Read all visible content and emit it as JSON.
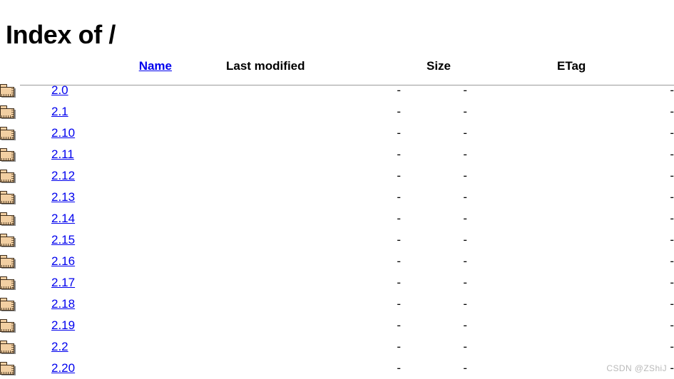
{
  "page": {
    "title": "Index of /"
  },
  "table": {
    "headers": {
      "name": "Name",
      "last_modified": "Last modified",
      "size": "Size",
      "etag": "ETag"
    },
    "empty_value": "-",
    "link_color": "#0000ee",
    "rule_color": "#9a9a9a",
    "rows": [
      {
        "icon": "folder-icon",
        "name": "2.0",
        "last_modified": "-",
        "size": "-",
        "etag": "-"
      },
      {
        "icon": "folder-icon",
        "name": "2.1",
        "last_modified": "-",
        "size": "-",
        "etag": "-"
      },
      {
        "icon": "folder-icon",
        "name": "2.10",
        "last_modified": "-",
        "size": "-",
        "etag": "-"
      },
      {
        "icon": "folder-icon",
        "name": "2.11",
        "last_modified": "-",
        "size": "-",
        "etag": "-"
      },
      {
        "icon": "folder-icon",
        "name": "2.12",
        "last_modified": "-",
        "size": "-",
        "etag": "-"
      },
      {
        "icon": "folder-icon",
        "name": "2.13",
        "last_modified": "-",
        "size": "-",
        "etag": "-"
      },
      {
        "icon": "folder-icon",
        "name": "2.14",
        "last_modified": "-",
        "size": "-",
        "etag": "-"
      },
      {
        "icon": "folder-icon",
        "name": "2.15",
        "last_modified": "-",
        "size": "-",
        "etag": "-"
      },
      {
        "icon": "folder-icon",
        "name": "2.16",
        "last_modified": "-",
        "size": "-",
        "etag": "-"
      },
      {
        "icon": "folder-icon",
        "name": "2.17",
        "last_modified": "-",
        "size": "-",
        "etag": "-"
      },
      {
        "icon": "folder-icon",
        "name": "2.18",
        "last_modified": "-",
        "size": "-",
        "etag": "-"
      },
      {
        "icon": "folder-icon",
        "name": "2.19",
        "last_modified": "-",
        "size": "-",
        "etag": "-"
      },
      {
        "icon": "folder-icon",
        "name": "2.2",
        "last_modified": "-",
        "size": "-",
        "etag": "-"
      },
      {
        "icon": "folder-icon",
        "name": "2.20",
        "last_modified": "-",
        "size": "-",
        "etag": "-"
      }
    ]
  },
  "watermark": {
    "text": "CSDN @ZShiJ"
  }
}
